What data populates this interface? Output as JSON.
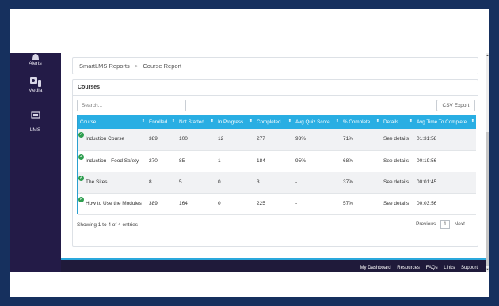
{
  "sidebar": {
    "items": [
      {
        "label": "Alerts",
        "icon": "bell-icon"
      },
      {
        "label": "Media",
        "icon": "media-icon"
      },
      {
        "label": "LMS",
        "icon": "lms-icon"
      }
    ]
  },
  "breadcrumb": {
    "root": "SmartLMS Reports",
    "separator": ">",
    "current": "Course Report"
  },
  "panel": {
    "title": "Courses",
    "search_placeholder": "Search...",
    "csv_label": "CSV Export"
  },
  "table": {
    "columns": [
      "Course",
      "Enrolled",
      "Not Started",
      "In Progress",
      "Completed",
      "Avg Quiz Score",
      "% Complete",
      "Details",
      "Avg Time To Complete"
    ],
    "rows": [
      {
        "course": "Induction Course",
        "enrolled": "389",
        "not_started": "100",
        "in_progress": "12",
        "completed": "277",
        "avg_quiz": "93%",
        "pct_complete": "71%",
        "details": "See details",
        "avg_time": "01:31:58"
      },
      {
        "course": "Induction - Food Safety",
        "enrolled": "270",
        "not_started": "85",
        "in_progress": "1",
        "completed": "184",
        "avg_quiz": "95%",
        "pct_complete": "68%",
        "details": "See details",
        "avg_time": "00:19:56"
      },
      {
        "course": "The Sites",
        "enrolled": "8",
        "not_started": "5",
        "in_progress": "0",
        "completed": "3",
        "avg_quiz": "-",
        "pct_complete": "37%",
        "details": "See details",
        "avg_time": "00:01:45"
      },
      {
        "course": "How to Use the Modules",
        "enrolled": "389",
        "not_started": "164",
        "in_progress": "0",
        "completed": "225",
        "avg_quiz": "-",
        "pct_complete": "57%",
        "details": "See details",
        "avg_time": "00:03:56"
      }
    ]
  },
  "info": {
    "entries": "Showing 1 to 4 of 4 entries"
  },
  "pager": {
    "previous": "Previous",
    "page": "1",
    "next": "Next"
  },
  "footer": {
    "links": [
      "My Dashboard",
      "Resources",
      "FAQs",
      "Links",
      "Support"
    ]
  },
  "colors": {
    "page_bg": "#16305e",
    "sidebar": "#231b47",
    "header_accent": "#29aee3",
    "status_dot": "#2e9e4f",
    "footer": "#1f1a3a"
  }
}
